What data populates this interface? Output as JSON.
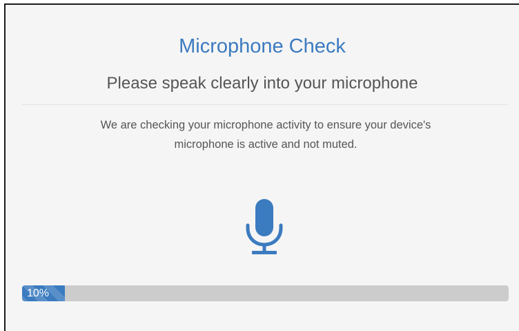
{
  "header": {
    "title": "Microphone Check",
    "subtitle": "Please speak clearly into your microphone"
  },
  "body": {
    "description_line1": "We are checking your microphone activity to ensure your device's",
    "description_line2": "microphone is active and not muted."
  },
  "icon": {
    "name": "microphone-icon",
    "color": "#3b7bbf"
  },
  "progress": {
    "value": 10,
    "label": "10%",
    "fill_color": "#3b7bbf",
    "track_color": "#cccccc"
  },
  "colors": {
    "accent": "#3b7bbf",
    "text": "#555555",
    "background": "#f5f5f5"
  }
}
